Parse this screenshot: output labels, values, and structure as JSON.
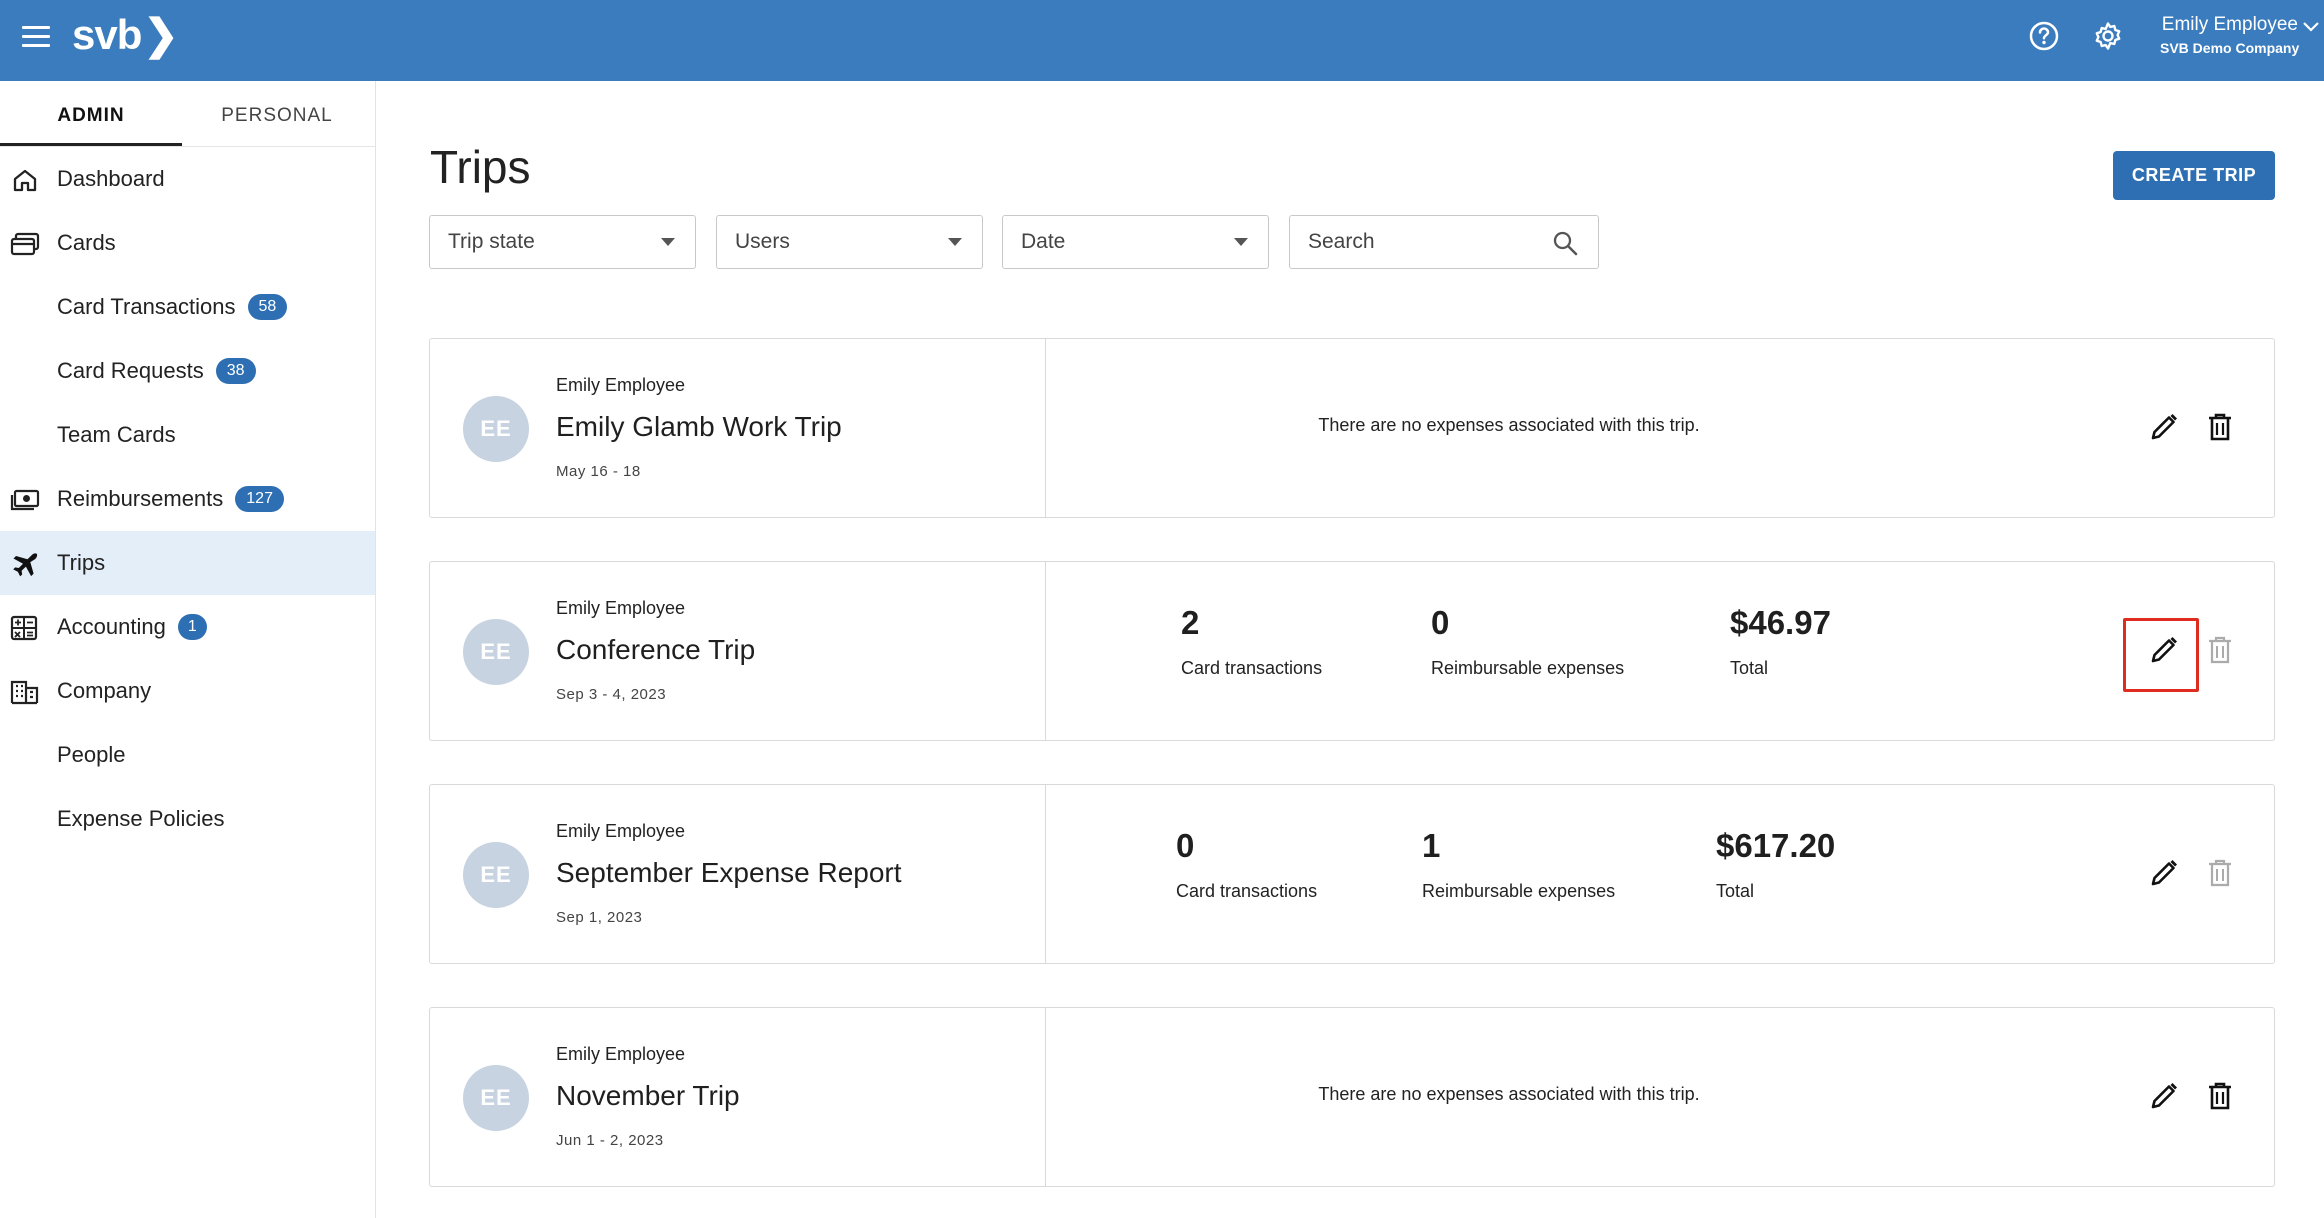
{
  "header": {
    "logo_text": "svb",
    "user_name": "Emily Employee",
    "user_company": "SVB Demo Company",
    "brand_color": "#3a7cbd",
    "icons": [
      "menu-icon",
      "help-icon",
      "gear-icon",
      "chevron-down-icon"
    ]
  },
  "sidebar": {
    "tabs": [
      {
        "label": "ADMIN",
        "active": true
      },
      {
        "label": "PERSONAL",
        "active": false
      }
    ],
    "items": [
      {
        "label": "Dashboard",
        "icon": "home-icon"
      },
      {
        "label": "Cards",
        "icon": "cards-icon"
      },
      {
        "label": "Card Transactions",
        "badge": "58"
      },
      {
        "label": "Card Requests",
        "badge": "38"
      },
      {
        "label": "Team Cards"
      },
      {
        "label": "Reimbursements",
        "icon": "cash-icon",
        "badge": "127"
      },
      {
        "label": "Trips",
        "icon": "airplane-icon",
        "active": true
      },
      {
        "label": "Accounting",
        "icon": "accounting-icon",
        "badge": "1"
      },
      {
        "label": "Company",
        "icon": "building-icon"
      },
      {
        "label": "People"
      },
      {
        "label": "Expense Policies"
      }
    ]
  },
  "main": {
    "title": "Trips",
    "create_button": "CREATE TRIP",
    "filters": {
      "trip_state": "Trip state",
      "users": "Users",
      "date": "Date",
      "search_placeholder": "Search"
    },
    "trips": [
      {
        "owner": "Emily Employee",
        "initials": "EE",
        "name": "Emily Glamb Work Trip",
        "dates": "May 16 - 18",
        "empty_message": "There are no expenses associated with this trip.",
        "delete_enabled": true
      },
      {
        "owner": "Emily Employee",
        "initials": "EE",
        "name": "Conference Trip",
        "dates": "Sep 3 - 4, 2023",
        "card_transactions": "2",
        "card_transactions_label": "Card transactions",
        "reimbursable": "0",
        "reimbursable_label": "Reimbursable expenses",
        "total": "$46.97",
        "total_label": "Total",
        "delete_enabled": false,
        "edit_highlighted": true
      },
      {
        "owner": "Emily Employee",
        "initials": "EE",
        "name": "September Expense Report",
        "dates": "Sep 1, 2023",
        "card_transactions": "0",
        "card_transactions_label": "Card transactions",
        "reimbursable": "1",
        "reimbursable_label": "Reimbursable expenses",
        "total": "$617.20",
        "total_label": "Total",
        "delete_enabled": false
      },
      {
        "owner": "Emily Employee",
        "initials": "EE",
        "name": "November Trip",
        "dates": "Jun 1 - 2, 2023",
        "empty_message": "There are no expenses associated with this trip.",
        "delete_enabled": true
      }
    ]
  }
}
